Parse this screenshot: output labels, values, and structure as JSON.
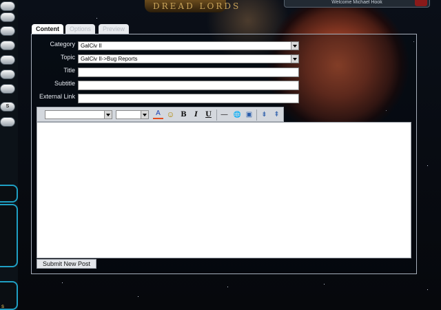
{
  "banner": {
    "logo_text": "DREAD LORDS",
    "top_box_text": "Welcome Michael Hook"
  },
  "side": {
    "pill_letter": "S",
    "bottom_text": "s"
  },
  "tabs": [
    {
      "label": "Content"
    },
    {
      "label": "Options"
    },
    {
      "label": "Preview"
    }
  ],
  "form": {
    "category": {
      "label": "Category",
      "value": "GalCiv II"
    },
    "topic": {
      "label": "Topic",
      "value": "GalCiv II->Bug Reports"
    },
    "title": {
      "label": "Title",
      "value": ""
    },
    "subtitle": {
      "label": "Subtitle",
      "value": ""
    },
    "external_link": {
      "label": "External Link",
      "value": ""
    }
  },
  "toolbar": {
    "font_color_glyph": "A",
    "emoticon_glyph": "☺",
    "bold_glyph": "B",
    "italic_glyph": "I",
    "underline_glyph": "U",
    "hr_glyph": "—",
    "link_glyph": "🌐",
    "image_glyph": "▣",
    "indent_glyph": "⇟",
    "outdent_glyph": "⇞"
  },
  "submit_label": "Submit New Post",
  "colors": {
    "accent_teal": "#1fa0c4",
    "planet": "#c75a35",
    "panel_border": "#a8b0bc"
  }
}
